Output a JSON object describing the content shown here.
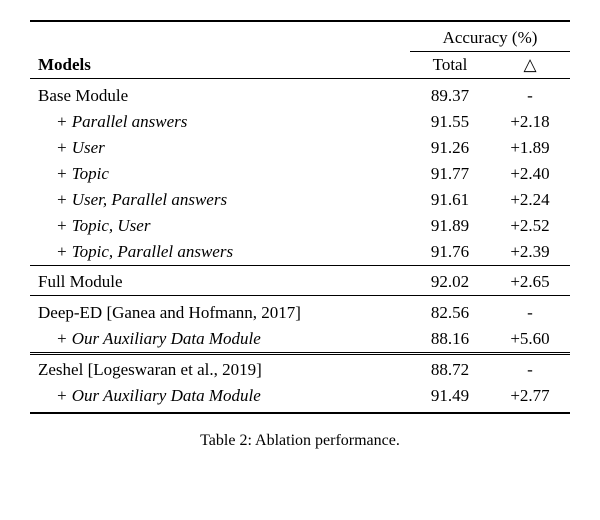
{
  "headers": {
    "models": "Models",
    "accuracy": "Accuracy (%)",
    "total": "Total",
    "delta": "△"
  },
  "section1": {
    "base": {
      "label": "Base Module",
      "total": "89.37",
      "delta": "-"
    },
    "r1": {
      "label": "+ Parallel answers",
      "total": "91.55",
      "delta": "+2.18"
    },
    "r2": {
      "label": "+ User",
      "total": "91.26",
      "delta": "+1.89"
    },
    "r3": {
      "label": "+ Topic",
      "total": "91.77",
      "delta": "+2.40"
    },
    "r4": {
      "label": "+ User, Parallel answers",
      "total": "91.61",
      "delta": "+2.24"
    },
    "r5": {
      "label": "+ Topic, User",
      "total": "91.89",
      "delta": "+2.52"
    },
    "r6": {
      "label": "+ Topic, Parallel answers",
      "total": "91.76",
      "delta": "+2.39"
    }
  },
  "section2": {
    "full": {
      "label": "Full Module",
      "total": "92.02",
      "delta": "+2.65"
    }
  },
  "section3": {
    "deep": {
      "label": "Deep-ED [Ganea and Hofmann, 2017]",
      "total": "82.56",
      "delta": "-"
    },
    "aux": {
      "label": "+ Our Auxiliary Data Module",
      "total": "88.16",
      "delta": "+5.60"
    }
  },
  "section4": {
    "zeshel": {
      "label": "Zeshel [Logeswaran et al., 2019]",
      "total": "88.72",
      "delta": "-"
    },
    "aux": {
      "label": "+ Our Auxiliary Data Module",
      "total": "91.49",
      "delta": "+2.77"
    }
  },
  "caption_prefix": "Table 2: ",
  "caption_text": "Ablation performance.",
  "chart_data": {
    "type": "table",
    "title": "Table 2: Ablation performance.",
    "columns": [
      "Models",
      "Total",
      "△"
    ],
    "groups": [
      {
        "rows": [
          [
            "Base Module",
            89.37,
            null
          ],
          [
            "+ Parallel answers",
            91.55,
            2.18
          ],
          [
            "+ User",
            91.26,
            1.89
          ],
          [
            "+ Topic",
            91.77,
            2.4
          ],
          [
            "+ User, Parallel answers",
            91.61,
            2.24
          ],
          [
            "+ Topic, User",
            91.89,
            2.52
          ],
          [
            "+ Topic, Parallel answers",
            91.76,
            2.39
          ]
        ]
      },
      {
        "rows": [
          [
            "Full Module",
            92.02,
            2.65
          ]
        ]
      },
      {
        "rows": [
          [
            "Deep-ED [Ganea and Hofmann, 2017]",
            82.56,
            null
          ],
          [
            "+ Our Auxiliary Data Module",
            88.16,
            5.6
          ]
        ]
      },
      {
        "rows": [
          [
            "Zeshel [Logeswaran et al., 2019]",
            88.72,
            null
          ],
          [
            "+ Our Auxiliary Data Module",
            91.49,
            2.77
          ]
        ]
      }
    ]
  }
}
